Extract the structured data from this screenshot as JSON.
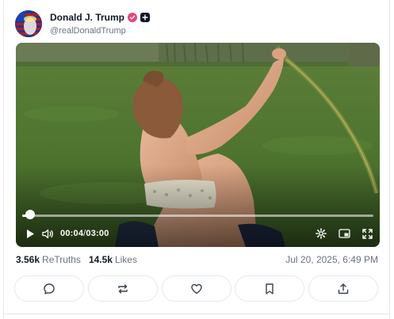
{
  "post": {
    "author": {
      "display_name": "Donald J. Trump",
      "handle": "@realDonaldTrump",
      "verified_badge": "verified-icon",
      "plus_badge": "plus-icon"
    },
    "video": {
      "current_time": "00:04",
      "separator": "/",
      "duration": "03:00",
      "progress_fraction": 0.022,
      "icons": [
        "play-icon",
        "volume-icon",
        "settings-icon",
        "picture-in-picture-icon",
        "fullscreen-icon"
      ]
    },
    "stats": {
      "retruths_count": "3.56k",
      "retruths_label": "ReTruths",
      "likes_count": "14.5k",
      "likes_label": "Likes",
      "timestamp": "Jul 20, 2025, 6:49 PM"
    },
    "actions": [
      "reply-icon",
      "retruth-icon",
      "like-icon",
      "bookmark-icon",
      "share-icon"
    ],
    "colors": {
      "verified": "#e8467c",
      "text_primary": "#111827",
      "text_secondary": "#6b7280",
      "border": "#e5e7eb"
    }
  }
}
